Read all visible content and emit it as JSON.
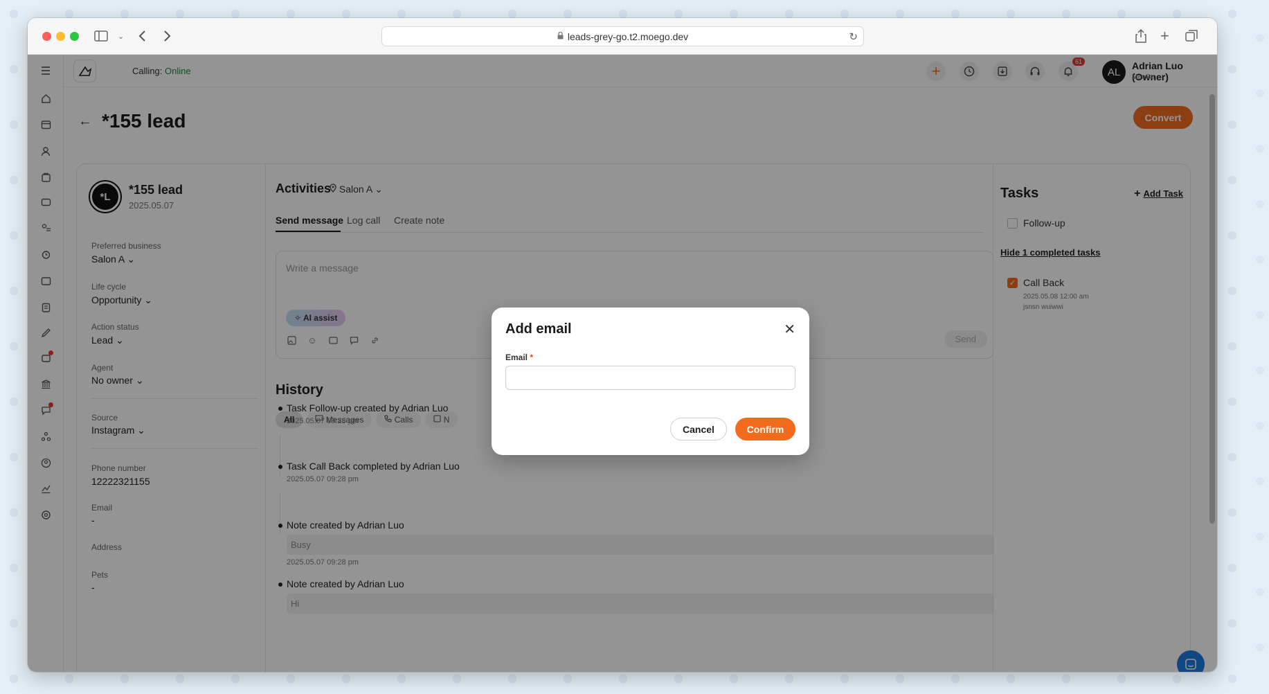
{
  "browser": {
    "url": "leads-grey-go.t2.moego.dev"
  },
  "topbar": {
    "calling_label": "Calling:",
    "calling_status": "Online",
    "notification_count": "61",
    "user_initials": "AL",
    "user_name": "Adrian Luo (Owner)",
    "user_company": "MeoGo"
  },
  "page": {
    "title": "*155 lead",
    "convert_label": "Convert"
  },
  "lead": {
    "avatar_initials": "*L",
    "name": "*155 lead",
    "date": "2025.05.07",
    "preferred_business_label": "Preferred business",
    "preferred_business": "Salon A",
    "life_cycle_label": "Life cycle",
    "life_cycle": "Opportunity",
    "action_status_label": "Action status",
    "action_status": "Lead",
    "agent_label": "Agent",
    "agent": "No owner",
    "source_label": "Source",
    "source": "Instagram",
    "phone_label": "Phone number",
    "phone": "12222321155",
    "email_label": "Email",
    "email": "-",
    "address_label": "Address",
    "pets_label": "Pets",
    "pets": "-"
  },
  "activities": {
    "title": "Activities",
    "location": "Salon A",
    "tabs": [
      "Send message",
      "Log call",
      "Create note"
    ],
    "message_placeholder": "Write a message",
    "ai_assist": "AI assist",
    "send": "Send"
  },
  "history": {
    "title": "History",
    "filters": [
      "All",
      "Messages",
      "Calls",
      "N"
    ],
    "items": [
      {
        "text": "Task Follow-up created by Adrian Luo",
        "date": "2025.05.07 09:28 pm"
      },
      {
        "text": "Task Call Back completed by Adrian Luo",
        "date": "2025.05.07 09:28 pm"
      },
      {
        "text": "Note created by Adrian Luo",
        "note": "Busy",
        "date": "2025.05.07 09:28 pm"
      },
      {
        "text": "Note created by Adrian Luo",
        "note": "Hi"
      }
    ]
  },
  "tasks": {
    "title": "Tasks",
    "add_task": "Add Task",
    "open": [
      {
        "label": "Follow-up"
      }
    ],
    "hide_completed": "Hide 1 completed tasks",
    "completed": [
      {
        "label": "Call Back",
        "due": "2025.05.08 12:00 am",
        "assignee": "jsnsn wuiwwi"
      }
    ]
  },
  "modal": {
    "title": "Add email",
    "email_label": "Email",
    "required_mark": "*",
    "email_value": "",
    "cancel": "Cancel",
    "confirm": "Confirm"
  },
  "colors": {
    "accent": "#f26b1d",
    "online": "#1a8a3a",
    "overlay": "rgba(0,0,0,0.42)"
  }
}
